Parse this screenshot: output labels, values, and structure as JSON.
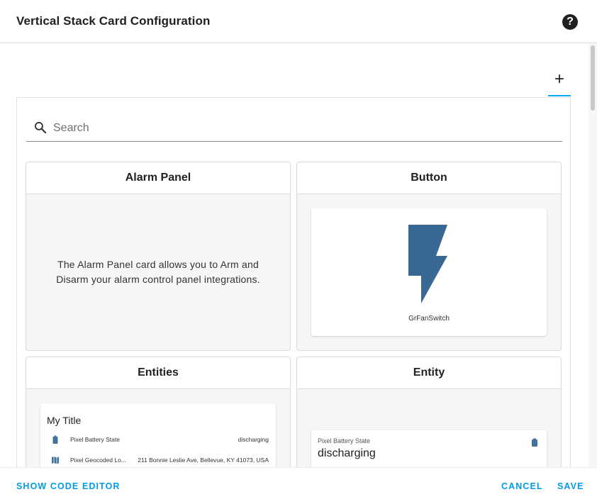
{
  "dialog": {
    "title": "Vertical Stack Card Configuration",
    "help_icon": "help-circle-icon"
  },
  "tabs": {
    "add_label": "+",
    "accent_color": "#03a9f4"
  },
  "search": {
    "placeholder": "Search",
    "value": ""
  },
  "cards": {
    "alarm_panel": {
      "title": "Alarm Panel",
      "description": "The Alarm Panel card allows you to Arm and Disarm your alarm control panel integrations."
    },
    "button": {
      "title": "Button",
      "preview_name": "GrFanSwitch",
      "icon": "flash-icon",
      "icon_color": "#3a6894"
    },
    "entities": {
      "title": "Entities",
      "preview_title": "My Title",
      "rows": [
        {
          "name": "Pixel Battery State",
          "state": "discharging",
          "icon": "battery-lock-icon"
        },
        {
          "name": "Pixel Geocoded Lo...",
          "state": "211 Bonnie Leslie Ave, Bellevue, KY 41073, USA",
          "icon": "map-icon"
        }
      ]
    },
    "entity": {
      "title": "Entity",
      "label": "Pixel Battery State",
      "state": "discharging",
      "icon": "battery-lock-icon"
    }
  },
  "footer": {
    "show_code_editor": "SHOW CODE EDITOR",
    "cancel": "CANCEL",
    "save": "SAVE",
    "accent_color": "#039be5"
  }
}
